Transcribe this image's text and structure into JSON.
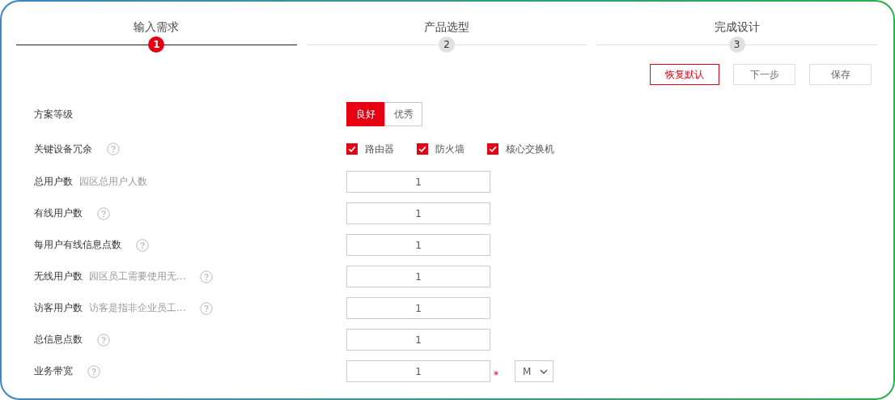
{
  "steps": [
    {
      "label": "输入需求",
      "number": "1",
      "selected": true
    },
    {
      "label": "产品选型",
      "number": "2",
      "selected": false
    },
    {
      "label": "完成设计",
      "number": "3",
      "selected": false
    }
  ],
  "actions": [
    {
      "label": "恢复默认",
      "kind": "primary"
    },
    {
      "label": "下一步",
      "kind": "default"
    },
    {
      "label": "保存",
      "kind": "default"
    }
  ],
  "form": [
    {
      "kind": "segmented",
      "label": "方案等级",
      "help": false,
      "options": [
        {
          "label": "良好",
          "selected": true
        },
        {
          "label": "优秀",
          "selected": false
        }
      ]
    },
    {
      "kind": "checkboxes",
      "label": "关键设备冗余",
      "help": true,
      "options": [
        {
          "label": "路由器",
          "checked": true
        },
        {
          "label": "防火墙",
          "checked": true
        },
        {
          "label": "核心交换机",
          "checked": true
        }
      ]
    },
    {
      "kind": "input",
      "label": "总用户数",
      "hint": "园区总用户人数",
      "help": false,
      "value": "1"
    },
    {
      "kind": "input",
      "label": "有线用户数",
      "help": true,
      "value": "1"
    },
    {
      "kind": "input",
      "label": "每用户有线信息点数",
      "help": true,
      "value": "1"
    },
    {
      "kind": "input",
      "label": "无线用户数",
      "hint": "园区员工需要使用无...",
      "help": true,
      "value": "1"
    },
    {
      "kind": "input",
      "label": "访客用户数",
      "hint": "访客是指非企业员工...",
      "help": true,
      "value": "1"
    },
    {
      "kind": "input",
      "label": "总信息点数",
      "help": true,
      "value": "1"
    },
    {
      "kind": "input",
      "label": "业务带宽",
      "help": true,
      "value": "1",
      "required_mark": "*",
      "unit": "M"
    }
  ]
}
